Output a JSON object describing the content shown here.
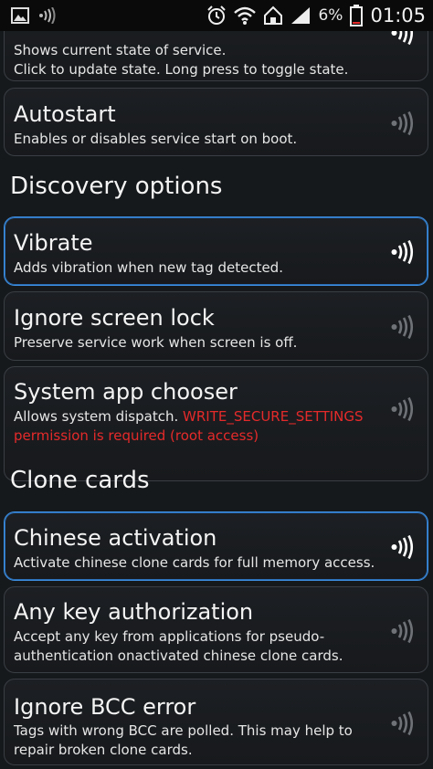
{
  "status_bar": {
    "battery_percent": "6%",
    "time": "01:05",
    "left_icons": [
      "gallery-icon",
      "nfc-waves-icon"
    ],
    "right_icons": [
      "alarm-icon",
      "wifi-icon",
      "home-icon",
      "signal-icon",
      "battery-icon"
    ]
  },
  "colors": {
    "accent": "#3d8fe0",
    "warning": "#e52a2a",
    "background": "#16191c"
  },
  "items": [
    {
      "desc": "Shows current state of service.\nClick to update state. Long press to toggle state.",
      "enabled": true
    },
    {
      "title": "Autostart",
      "desc": "Enables or disables service start on boot.",
      "enabled": false
    }
  ],
  "sections": [
    {
      "title": "Discovery options",
      "items": [
        {
          "title": "Vibrate",
          "desc": "Adds vibration when new tag detected.",
          "enabled": true
        },
        {
          "title": "Ignore screen lock",
          "desc": "Preserve service work when screen is off.",
          "enabled": false
        },
        {
          "title": "System app chooser",
          "desc": "Allows system dispatch.",
          "warning": "WRITE_SECURE_SETTINGS permission is required (root access)",
          "enabled": false
        }
      ]
    },
    {
      "title": "Clone cards",
      "items": [
        {
          "title": "Chinese activation",
          "desc": "Activate chinese clone cards for full memory access.",
          "enabled": true
        },
        {
          "title": "Any key authorization",
          "desc": "Accept any key from applications for pseudo-authentication onactivated chinese clone cards.",
          "enabled": false
        },
        {
          "title": "Ignore BCC error",
          "desc": "Tags with wrong BCC are polled. This may help to repair broken clone cards.",
          "enabled": false
        }
      ]
    }
  ]
}
